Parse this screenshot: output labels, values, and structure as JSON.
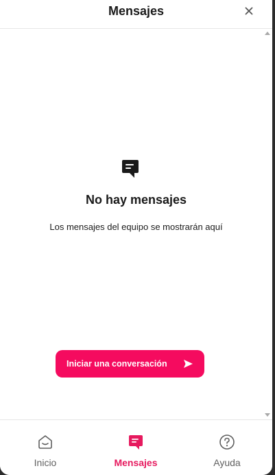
{
  "header": {
    "title": "Mensajes",
    "close_icon": "close-icon"
  },
  "empty_state": {
    "icon": "message-icon",
    "title": "No hay mensajes",
    "description": "Los mensajes del equipo se mostrarán aquí"
  },
  "action": {
    "label": "Iniciar una conversación",
    "icon": "send-icon"
  },
  "nav": {
    "items": [
      {
        "label": "Inicio",
        "icon": "home-icon",
        "active": false
      },
      {
        "label": "Mensajes",
        "icon": "message-icon",
        "active": true
      },
      {
        "label": "Ayuda",
        "icon": "help-icon",
        "active": false
      }
    ]
  },
  "colors": {
    "accent": "#f50b5f",
    "accent_text": "#e6195e",
    "text": "#1a1a1a",
    "muted": "#5f5f5f"
  }
}
